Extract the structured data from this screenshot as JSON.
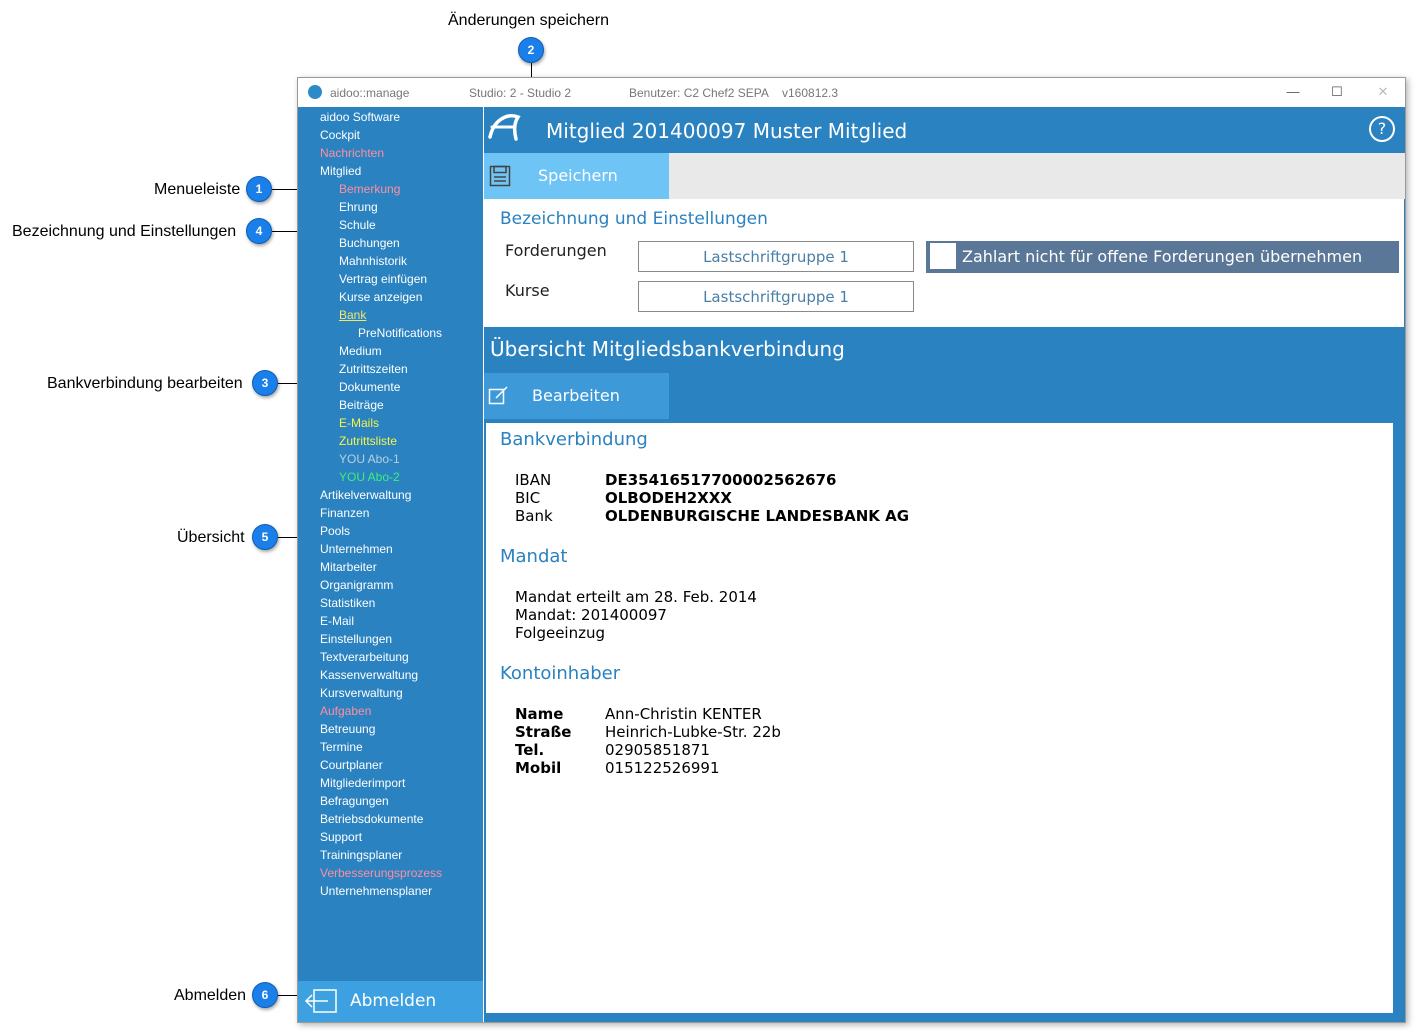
{
  "callouts": {
    "c1": {
      "num": "1",
      "label": "Menueleiste"
    },
    "c2": {
      "num": "2",
      "label": "Änderungen speichern"
    },
    "c3": {
      "num": "3",
      "label": "Bankverbindung bearbeiten"
    },
    "c4": {
      "num": "4",
      "label": "Bezeichnung und Einstellungen"
    },
    "c5": {
      "num": "5",
      "label": "Übersicht"
    },
    "c6": {
      "num": "6",
      "label": "Abmelden"
    }
  },
  "titlebar": {
    "app": "aidoo::manage",
    "studio": "Studio: 2 - Studio 2",
    "user": "Benutzer: C2 Chef2   SEPA",
    "version": "v160812.3",
    "minimize": "—",
    "maximize": "☐",
    "close": "✕"
  },
  "sidebar": {
    "items": [
      {
        "label": "aidoo Software",
        "style": ""
      },
      {
        "label": "Cockpit",
        "style": ""
      },
      {
        "label": "Nachrichten",
        "style": "red"
      },
      {
        "label": "Mitglied",
        "style": ""
      },
      {
        "label": "Bemerkung",
        "style": "red"
      },
      {
        "label": "Ehrung",
        "style": ""
      },
      {
        "label": "Schule",
        "style": ""
      },
      {
        "label": "Buchungen",
        "style": ""
      },
      {
        "label": "Mahnhistorik",
        "style": ""
      },
      {
        "label": "Vertrag einfügen",
        "style": ""
      },
      {
        "label": "Kurse anzeigen",
        "style": ""
      },
      {
        "label": "Bank",
        "style": "link"
      },
      {
        "label": "PreNotifications",
        "style": ""
      },
      {
        "label": "Medium",
        "style": ""
      },
      {
        "label": "Zutrittszeiten",
        "style": ""
      },
      {
        "label": "Dokumente",
        "style": ""
      },
      {
        "label": "Beiträge",
        "style": ""
      },
      {
        "label": "E-Mails",
        "style": "yellow"
      },
      {
        "label": "Zutrittsliste",
        "style": "yellow"
      },
      {
        "label": "YOU Abo-1",
        "style": "grey"
      },
      {
        "label": "YOU Abo-2",
        "style": "green"
      },
      {
        "label": "Artikelverwaltung",
        "style": ""
      },
      {
        "label": "Finanzen",
        "style": ""
      },
      {
        "label": "Pools",
        "style": ""
      },
      {
        "label": "Unternehmen",
        "style": ""
      },
      {
        "label": "Mitarbeiter",
        "style": ""
      },
      {
        "label": "Organigramm",
        "style": ""
      },
      {
        "label": "Statistiken",
        "style": ""
      },
      {
        "label": "E-Mail",
        "style": ""
      },
      {
        "label": "Einstellungen",
        "style": ""
      },
      {
        "label": "Textverarbeitung",
        "style": ""
      },
      {
        "label": "Kassenverwaltung",
        "style": ""
      },
      {
        "label": "Kursverwaltung",
        "style": ""
      },
      {
        "label": "Aufgaben",
        "style": "red"
      },
      {
        "label": "Betreuung",
        "style": ""
      },
      {
        "label": "Termine",
        "style": ""
      },
      {
        "label": "Courtplaner",
        "style": ""
      },
      {
        "label": "Mitgliederimport",
        "style": ""
      },
      {
        "label": "Befragungen",
        "style": ""
      },
      {
        "label": "Betriebsdokumente",
        "style": ""
      },
      {
        "label": "Support",
        "style": ""
      },
      {
        "label": "Trainingsplaner",
        "style": ""
      },
      {
        "label": "Verbesserungsprozess",
        "style": "red"
      },
      {
        "label": "Unternehmensplaner",
        "style": ""
      }
    ],
    "logout_label": "Abmelden"
  },
  "header": {
    "title": "Mitglied  201400097 Muster Mitglied",
    "help": "?"
  },
  "toolbar": {
    "save_label": "Speichern"
  },
  "settings": {
    "heading": "Bezeichnung und Einstellungen",
    "forderungen_label": "Forderungen",
    "forderungen_value": "Lastschriftgruppe 1",
    "kurse_label": "Kurse",
    "kurse_value": "Lastschriftgruppe 1",
    "checkbox_label": "Zahlart nicht für offene Forderungen übernehmen"
  },
  "overview": {
    "title": "Übersicht Mitgliedsbankverbindung",
    "edit_label": "Bearbeiten",
    "bank": {
      "heading": "Bankverbindung",
      "iban_key": "IBAN",
      "iban": "DE35416517700002562676",
      "bic_key": "BIC",
      "bic": "OLBODEH2XXX",
      "bank_key": "Bank",
      "bank": "OLDENBURGISCHE LANDESBANK AG"
    },
    "mandate": {
      "heading": "Mandat",
      "line1": "Mandat erteilt am 28. Feb. 2014",
      "line2": "Mandat: 201400097",
      "line3": "Folgeeinzug"
    },
    "holder": {
      "heading": "Kontoinhaber",
      "name_key": "Name",
      "name": "Ann-Christin KENTER",
      "street_key": "Straße",
      "street": "Heinrich-Lubke-Str. 22b",
      "tel_key": "Tel.",
      "tel": "02905851871",
      "mobil_key": "Mobil",
      "mobil": "015122526991"
    }
  }
}
